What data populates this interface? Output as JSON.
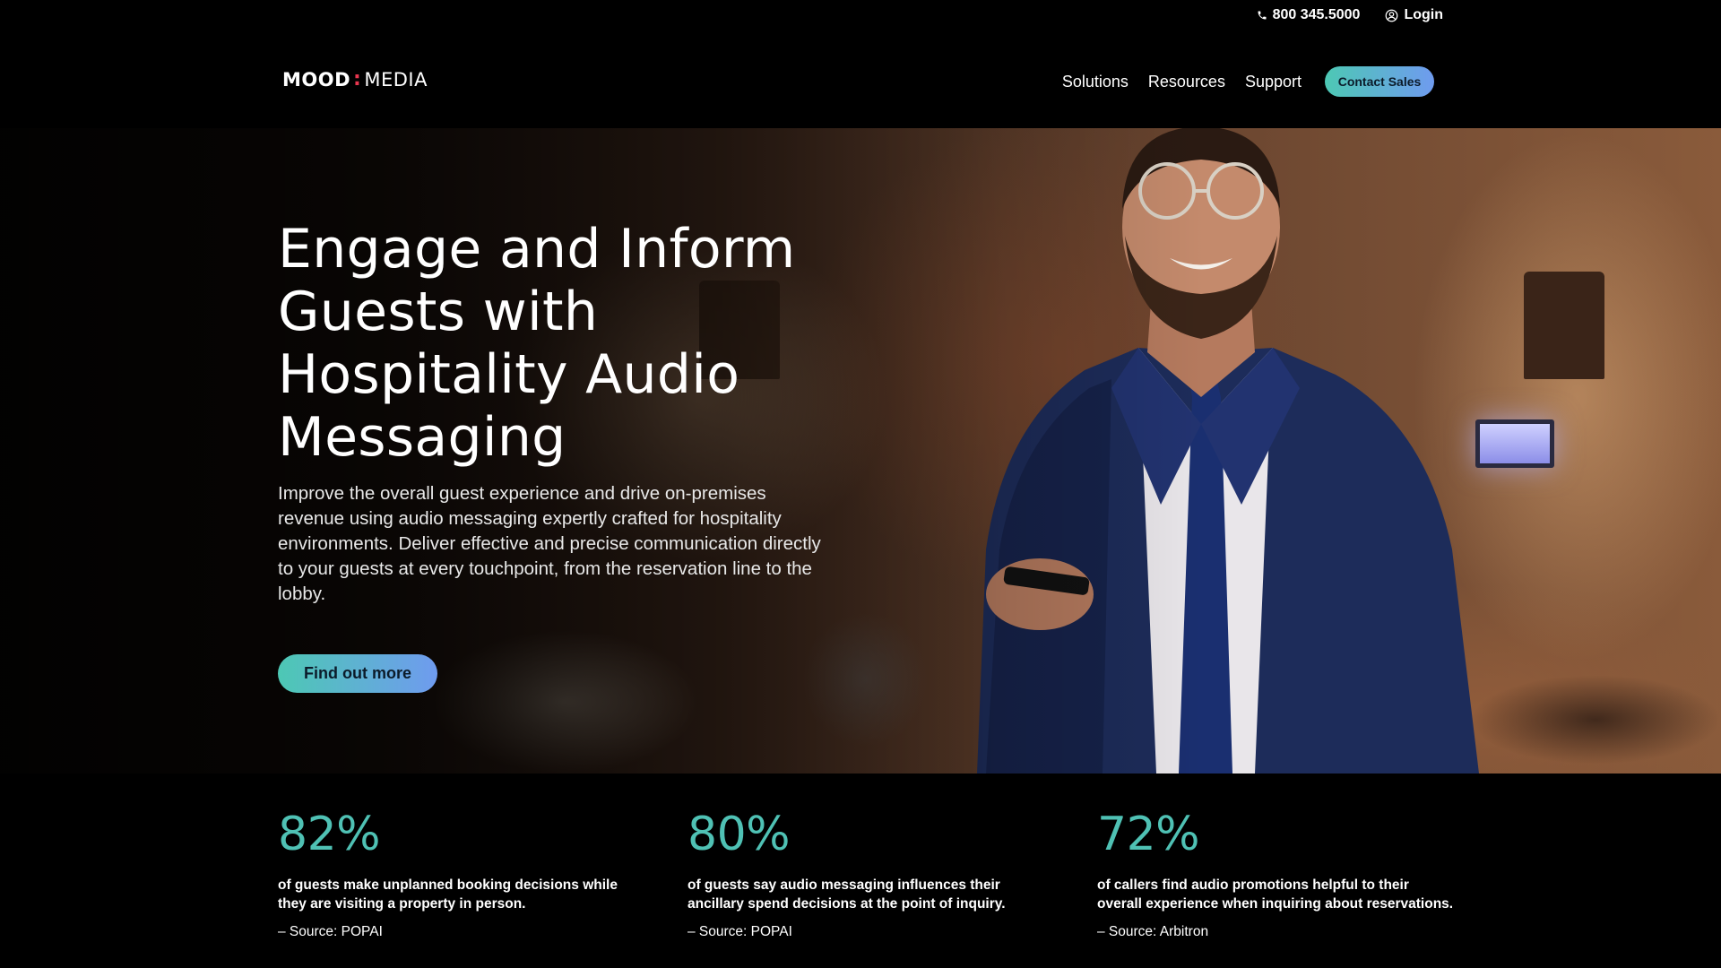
{
  "utility": {
    "phone": "800 345.5000",
    "phone_icon": "phone-icon",
    "login": "Login",
    "login_icon": "user-icon"
  },
  "header": {
    "logo": {
      "left": "MOOD",
      "separator": ":",
      "right": "MEDIA"
    },
    "nav": [
      "Solutions",
      "Resources",
      "Support"
    ],
    "cta": "Contact Sales"
  },
  "hero": {
    "title_lines": [
      "Engage and Inform",
      "Guests with",
      "Hospitality Audio",
      "Messaging"
    ],
    "text": "Improve the overall guest experience and drive on-premises revenue using audio messaging expertly crafted for hospitality environments. Deliver effective and precise communication directly to your guests at every touchpoint, from the reservation line to the lobby.",
    "cta": "Find out more"
  },
  "stats": [
    {
      "value": "82%",
      "desc": "of guests make unplanned booking decisions while they are visiting a property in person.",
      "source": "– Source: POPAI"
    },
    {
      "value": "80%",
      "desc": "of guests say audio messaging influences their ancillary spend decisions at the point of inquiry.",
      "source": "– Source: POPAI"
    },
    {
      "value": "72%",
      "desc": "of callers find audio promotions helpful to their overall experience when inquiring about reservations.",
      "source": "– Source: Arbitron"
    }
  ],
  "colors": {
    "accent_teal": "#4fc1b4",
    "accent_blue": "#6f9bef",
    "logo_colon": "#e8364f",
    "background": "#000000"
  }
}
